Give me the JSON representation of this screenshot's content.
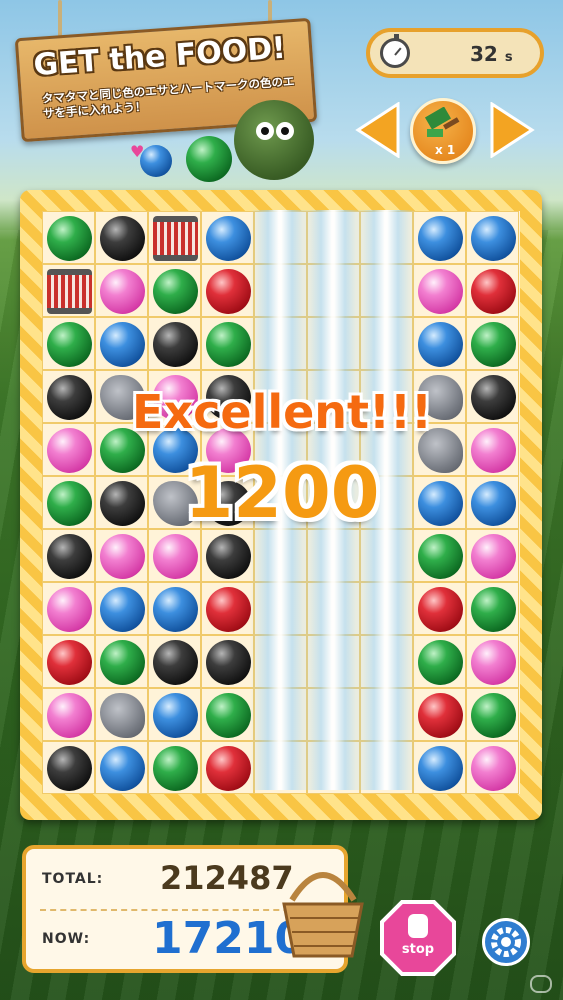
{
  "header": {
    "sign_title": "GET the FOOD!",
    "sign_instruction": "タマタマと同じ色のエサとハートマークの色のエサを手に入れよう！"
  },
  "timer": {
    "value": "32",
    "unit": "s"
  },
  "item": {
    "count": "x 1",
    "icon": "paint-brush-icon"
  },
  "combo": {
    "message": "Excellent!!!",
    "points": "1200"
  },
  "board": {
    "cols": 9,
    "rows": 11,
    "lightning_columns": [
      4,
      5,
      6
    ],
    "cells": [
      [
        "green",
        "black",
        "cage",
        "blue",
        null,
        null,
        null,
        "blue",
        "blue"
      ],
      [
        "cage",
        "pink",
        "green",
        "red",
        null,
        null,
        null,
        "pink",
        "red"
      ],
      [
        "green",
        "blue",
        "black",
        "green",
        null,
        null,
        null,
        "blue",
        "green"
      ],
      [
        "black",
        "rock",
        "pink",
        "black",
        null,
        null,
        null,
        "rock",
        "black"
      ],
      [
        "pink",
        "green",
        "blue",
        "pink",
        null,
        null,
        null,
        "rock",
        "pink"
      ],
      [
        "green",
        "black",
        "rock",
        "black",
        null,
        null,
        null,
        "blue",
        "blue"
      ],
      [
        "black",
        "pink",
        "pink",
        "black",
        null,
        null,
        null,
        "green",
        "pink"
      ],
      [
        "pink",
        "blue",
        "blue",
        "red",
        null,
        null,
        null,
        "red",
        "green"
      ],
      [
        "red",
        "green",
        "black",
        "black",
        null,
        null,
        null,
        "green",
        "pink"
      ],
      [
        "pink",
        "rock",
        "blue",
        "green",
        null,
        null,
        null,
        "red",
        "green"
      ],
      [
        "black",
        "blue",
        "green",
        "red",
        null,
        null,
        null,
        "blue",
        "pink"
      ]
    ]
  },
  "score": {
    "total_label": "TOTAL:",
    "total_value": "212487",
    "now_label": "NOW:",
    "now_value": "17210"
  },
  "controls": {
    "stop_label": "stop"
  },
  "colors": {
    "accent_orange": "#f59a12",
    "now_score_blue": "#1f6fd0",
    "board_yellow": "#f9c544"
  }
}
